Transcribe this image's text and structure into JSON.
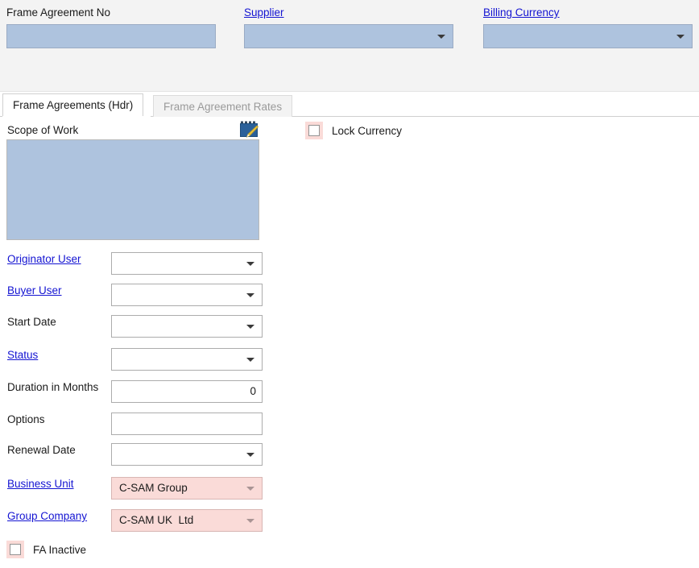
{
  "header": {
    "fields": [
      {
        "label": "Frame Agreement No",
        "link": false,
        "type": "input",
        "value": ""
      },
      {
        "label": "Supplier",
        "link": true,
        "type": "combo",
        "value": ""
      },
      {
        "label": "Billing Currency",
        "link": true,
        "type": "combo",
        "value": ""
      }
    ]
  },
  "tabs": [
    {
      "label": "Frame Agreements (Hdr)",
      "active": true
    },
    {
      "label": "Frame Agreement Rates",
      "active": false
    }
  ],
  "main": {
    "scope_of_work": {
      "label": "Scope of Work",
      "value": "",
      "edit_icon": "notepad-edit-icon"
    },
    "lock_currency": {
      "label": "Lock Currency",
      "checked": false
    },
    "fa_inactive": {
      "label": "FA Inactive",
      "checked": false
    },
    "rows": [
      {
        "label": "Originator User",
        "link": true,
        "type": "combo",
        "value": "",
        "pink": false
      },
      {
        "label": "Buyer User",
        "link": true,
        "type": "combo",
        "value": "",
        "pink": false
      },
      {
        "label": "Start Date",
        "link": false,
        "type": "combo",
        "value": "",
        "pink": false
      },
      {
        "label": "Status",
        "link": true,
        "type": "combo",
        "value": "",
        "pink": false
      },
      {
        "label": "Duration in Months",
        "link": false,
        "type": "number",
        "value": "0",
        "pink": false
      },
      {
        "label": "Options",
        "link": false,
        "type": "text",
        "value": "",
        "pink": false
      },
      {
        "label": "Renewal Date",
        "link": false,
        "type": "combo",
        "value": "",
        "pink": false
      },
      {
        "label": "Business Unit",
        "link": true,
        "type": "combo",
        "value": "C-SAM Group",
        "pink": true
      },
      {
        "label": "Group Company",
        "link": true,
        "type": "combo",
        "value": "C-SAM UK  Ltd",
        "pink": true
      }
    ]
  },
  "colors": {
    "header_band": "#f3f3f3",
    "field_blue": "#aec3de",
    "field_pink": "#fadbd8",
    "link_blue": "#1414d2",
    "icon_blue": "#2a6099",
    "icon_pencil": "#e8c43a"
  }
}
